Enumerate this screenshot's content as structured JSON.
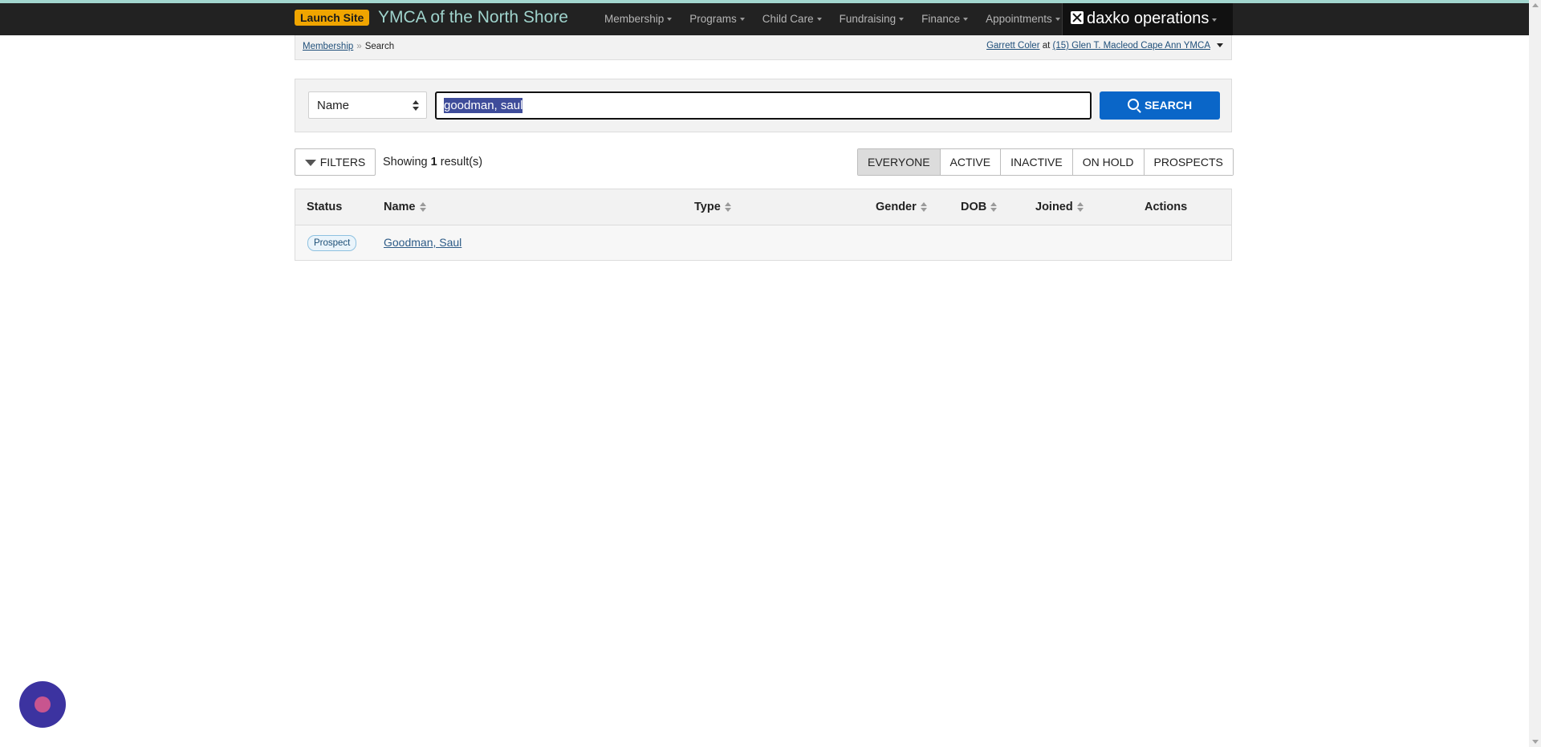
{
  "navbar": {
    "launch_label": "Launch Site",
    "brand": "YMCA of the North Shore",
    "menu": [
      {
        "label": "Membership"
      },
      {
        "label": "Programs"
      },
      {
        "label": "Child Care"
      },
      {
        "label": "Fundraising"
      },
      {
        "label": "Finance"
      },
      {
        "label": "Appointments"
      }
    ],
    "product": "daxko operations"
  },
  "breadcrumb": {
    "parent": "Membership",
    "separator": "»",
    "current": "Search",
    "user": "Garrett Coler",
    "at": "at",
    "location": "(15) Glen T. Macleod Cape Ann YMCA"
  },
  "search": {
    "field_selected": "Name",
    "query": "goodman, saul",
    "button_label": "SEARCH"
  },
  "toolbar": {
    "filters_label": "FILTERS",
    "showing_prefix": "Showing",
    "result_count": "1",
    "showing_suffix": "result(s)",
    "segments": [
      {
        "label": "EVERYONE",
        "active": true
      },
      {
        "label": "ACTIVE",
        "active": false
      },
      {
        "label": "INACTIVE",
        "active": false
      },
      {
        "label": "ON HOLD",
        "active": false
      },
      {
        "label": "PROSPECTS",
        "active": false
      }
    ]
  },
  "table": {
    "columns": [
      "Status",
      "Name",
      "Type",
      "Gender",
      "DOB",
      "Joined",
      "Actions"
    ],
    "rows": [
      {
        "status": "Prospect",
        "name": "Goodman, Saul",
        "type": "",
        "gender": "",
        "dob": "",
        "joined": "",
        "actions": ""
      }
    ]
  },
  "colors": {
    "navbar_bg": "#222222",
    "brand": "#9fd3cc",
    "launch_bg": "#f0a500",
    "primary_button": "#0a66c8",
    "chat_bubble": "#3c33a0"
  }
}
